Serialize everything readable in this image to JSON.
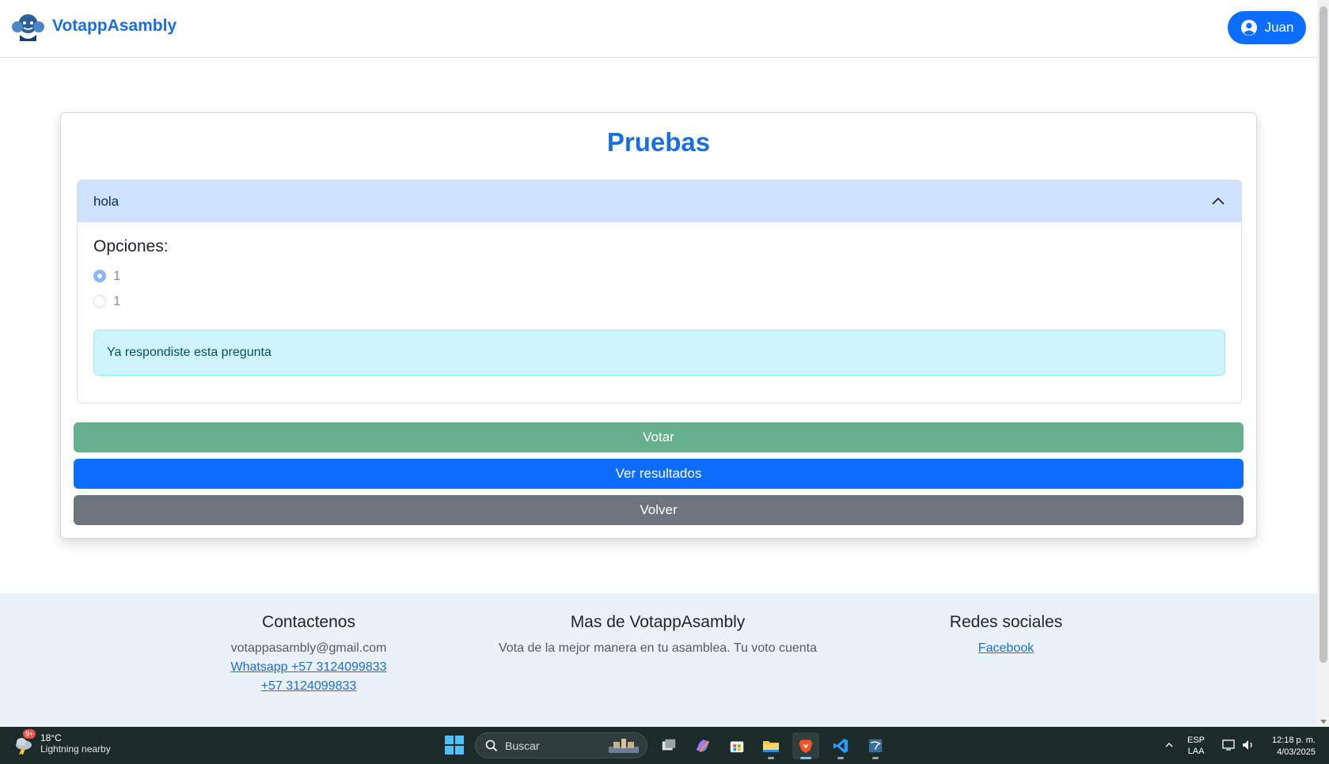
{
  "navbar": {
    "brand": "VotappAsambly",
    "user": "Juan"
  },
  "card": {
    "title": "Pruebas",
    "question": "hola",
    "options_label": "Opciones:",
    "options": [
      {
        "label": "1",
        "selected": true
      },
      {
        "label": "1",
        "selected": false
      }
    ],
    "alert": "Ya respondiste esta pregunta",
    "buttons": {
      "vote": "Votar",
      "results": "Ver resultados",
      "back": "Volver"
    }
  },
  "footer": {
    "contact": {
      "title": "Contactenos",
      "email": "votappasambly@gmail.com",
      "whatsapp": "Whatsapp +57 3124099833",
      "phone": "+57 3124099833"
    },
    "more": {
      "title": "Mas de VotappAsambly",
      "text": "Vota de la mejor manera en tu asamblea. Tu voto cuenta"
    },
    "social": {
      "title": "Redes sociales",
      "facebook": "Facebook"
    }
  },
  "taskbar": {
    "weather_badge": "9+",
    "temperature": "18°C",
    "weather_desc": "Lightning nearby",
    "search_placeholder": "Buscar",
    "lang_top": "ESP",
    "lang_bottom": "LAA",
    "time": "12:18 p. m.",
    "date": "4/03/2025"
  },
  "colors": {
    "brand_blue": "#1a6fe0",
    "primary": "#0d6efd",
    "success": "#67b08f",
    "secondary": "#6c757d",
    "alert_bg": "#cff4fc",
    "accordion_header": "#cfe2ff",
    "footer_bg": "#eaf1fb"
  }
}
